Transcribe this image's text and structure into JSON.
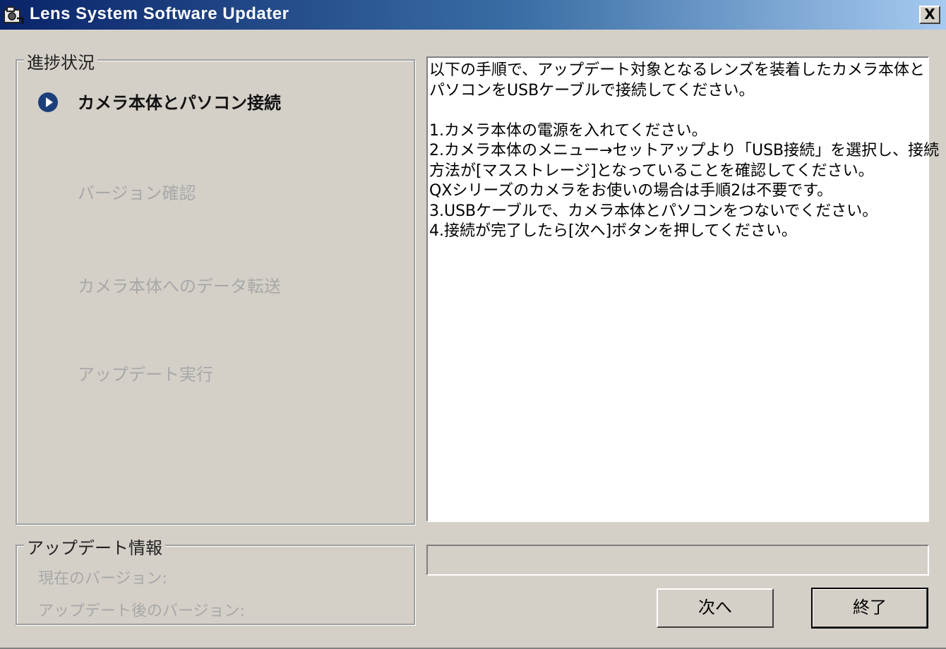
{
  "window": {
    "title": "Lens System Software Updater",
    "close_label": "X"
  },
  "progress_panel": {
    "legend": "進捗状況",
    "steps": [
      {
        "label": "カメラ本体とパソコン接続",
        "state": "active"
      },
      {
        "label": "バージョン確認",
        "state": "disabled"
      },
      {
        "label": "カメラ本体へのデータ転送",
        "state": "disabled"
      },
      {
        "label": "アップデート実行",
        "state": "disabled"
      }
    ]
  },
  "update_info": {
    "legend": "アップデート情報",
    "current_version_label": "現在のバージョン:",
    "updated_version_label": "アップデート後のバージョン:"
  },
  "instructions": {
    "lines": [
      "以下の手順で、アップデート対象となるレンズを装着したカメラ本体と",
      "パソコンをUSBケーブルで接続してください。",
      "",
      "1.カメラ本体の電源を入れてください。",
      "2.カメラ本体のメニュー→セットアップより「USB接続」を選択し、接続",
      "方法が[マスストレージ]となっていることを確認してください。",
      "QXシリーズのカメラをお使いの場合は手順2は不要です。",
      "3.USBケーブルで、カメラ本体とパソコンをつないでください。",
      "4.接続が完了したら[次へ]ボタンを押してください。"
    ]
  },
  "progress_bar": {
    "value": 0
  },
  "buttons": {
    "next_label": "次へ",
    "exit_label": "終了"
  },
  "colors": {
    "title_gradient_start": "#0a246a",
    "active_step_icon": "#1c3f7a",
    "disabled_text": "#a8a8a8"
  },
  "icons": {
    "app": "updater-app-icon",
    "active_step": "play-circle-icon"
  }
}
